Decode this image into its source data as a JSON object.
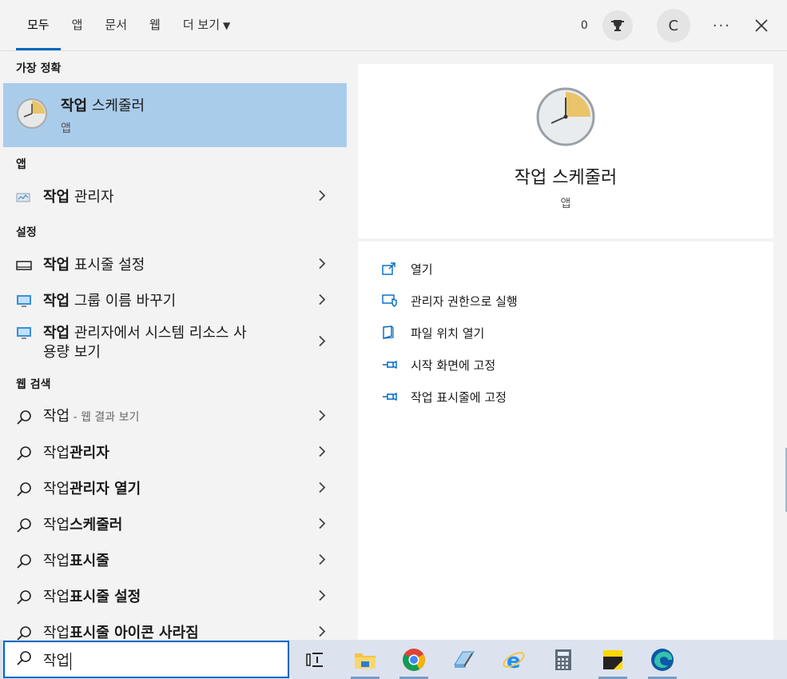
{
  "header": {
    "tabs": [
      {
        "label": "모두",
        "active": true
      },
      {
        "label": "앱"
      },
      {
        "label": "문서"
      },
      {
        "label": "웹"
      },
      {
        "label": "더 보기"
      }
    ],
    "points": "0",
    "avatar_initial": "C",
    "more_label": "···"
  },
  "left": {
    "sections": {
      "best": "가장 정확",
      "apps": "앱",
      "settings": "설정",
      "web": "웹 검색"
    },
    "best_match": {
      "bold": "작업",
      "rest": " 스케줄러",
      "type": "앱"
    },
    "apps": [
      {
        "bold": "작업",
        "rest": " 관리자",
        "icon": "task-manager-icon"
      }
    ],
    "settings": [
      {
        "bold": "작업",
        "rest": " 표시줄 설정",
        "icon": "taskbar-icon"
      },
      {
        "bold": "작업",
        "rest": " 그룹 이름 바꾸기",
        "icon": "monitor-icon"
      },
      {
        "bold": "작업",
        "rest": " 관리자에서 시스템 리소스 사",
        "line2": "용량 보기",
        "icon": "monitor-icon"
      }
    ],
    "web": [
      {
        "plain": "작업",
        "sub": " - 웹 결과 보기"
      },
      {
        "plain": "작업",
        "bold": "관리자"
      },
      {
        "plain": "작업",
        "bold": "관리자 열기"
      },
      {
        "plain": "작업",
        "bold": "스케줄러"
      },
      {
        "plain": "작업",
        "bold": "표시줄"
      },
      {
        "plain": "작업",
        "bold": "표시줄 설정"
      },
      {
        "plain": "작업",
        "bold": "표시줄 아이콘 사라짐"
      }
    ]
  },
  "detail": {
    "name": "작업 스케줄러",
    "type": "앱",
    "actions": [
      {
        "label": "열기",
        "icon": "open-icon"
      },
      {
        "label": "관리자 권한으로 실행",
        "icon": "shield-icon"
      },
      {
        "label": "파일 위치 열기",
        "icon": "folder-location-icon"
      },
      {
        "label": "시작 화면에 고정",
        "icon": "pin-icon"
      },
      {
        "label": "작업 표시줄에 고정",
        "icon": "pin-icon"
      }
    ]
  },
  "taskbar": {
    "search_value": "작업",
    "icons": [
      "task-view-icon",
      "file-explorer-icon",
      "chrome-icon",
      "notepad-icon",
      "internet-explorer-icon",
      "calculator-icon",
      "sticky-notes-icon",
      "edge-icon"
    ]
  },
  "colors": {
    "accent": "#0067c0",
    "selected": "#a9cceb",
    "link_icon": "#0067c0"
  }
}
